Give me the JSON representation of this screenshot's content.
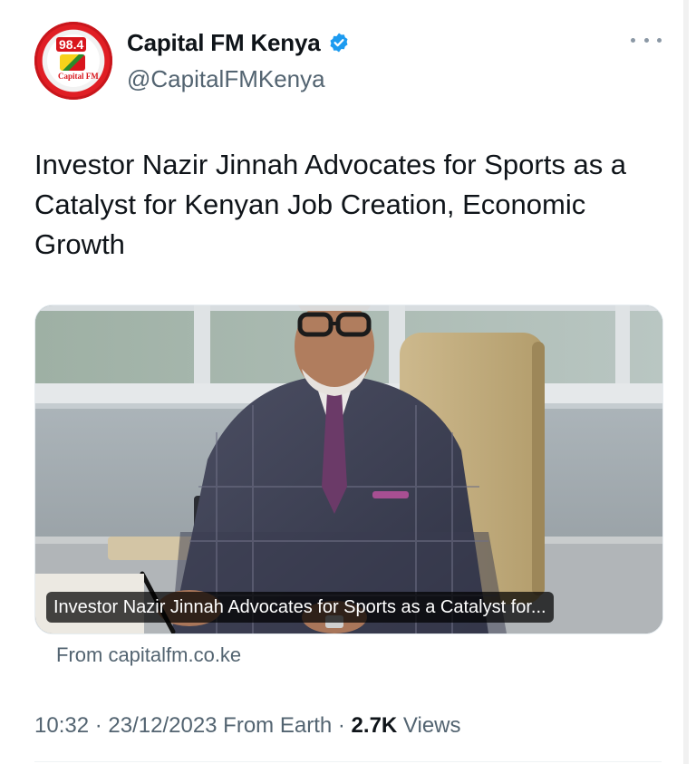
{
  "account": {
    "display_name": "Capital FM Kenya",
    "handle": "@CapitalFMKenya",
    "avatar": {
      "frequency": "98.4",
      "brand": "Capital FM"
    },
    "verified_icon": "verified-badge-icon"
  },
  "tweet": {
    "text": "Investor Nazir Jinnah Advocates for Sports as a Catalyst for Kenyan Job Creation, Economic Growth"
  },
  "card": {
    "caption": "Investor Nazir Jinnah Advocates for Sports as a Catalyst for...",
    "source": "From capitalfm.co.ke"
  },
  "meta": {
    "time": "10:32",
    "separator_1": " · ",
    "date": "23/12/2023",
    "client": " From Earth",
    "separator_2": " · ",
    "views_count": "2.7K",
    "views_label": " Views"
  },
  "colors": {
    "verified_blue": "#1d9bf0",
    "secondary_text": "#536471",
    "primary_text": "#0f1419"
  }
}
